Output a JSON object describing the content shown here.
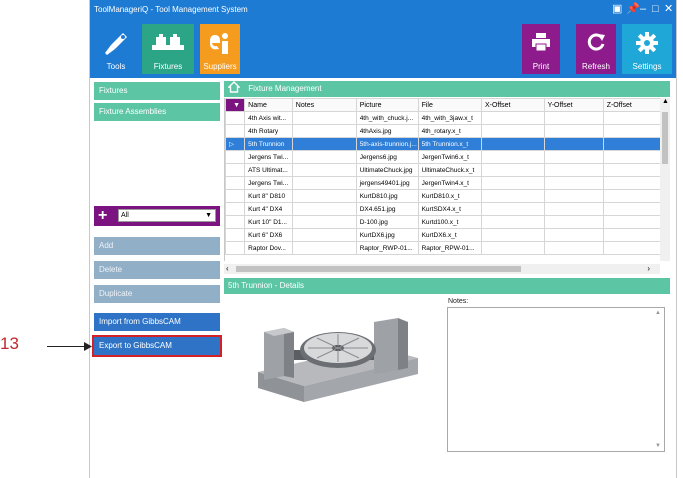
{
  "window": {
    "title": "ToolManageriQ - Tool Management System"
  },
  "toolbar": {
    "tools": "Tools",
    "fixtures": "Fixtures",
    "suppliers": "Suppliers",
    "print": "Print",
    "refresh": "Refresh",
    "settings": "Settings"
  },
  "sidebar": {
    "fixtures": "Fixtures",
    "fixture_assemblies": "Fixture Assemblies",
    "filter_value": "All",
    "add": "Add",
    "delete": "Delete",
    "duplicate": "Duplicate",
    "import": "Import from GibbsCAM",
    "export": "Export to GibbsCAM"
  },
  "fixture_management": {
    "title": "Fixture Management",
    "columns": [
      "Name",
      "Notes",
      "Picture",
      "File",
      "X-Offset",
      "Y-Offset",
      "Z-Offset"
    ],
    "rows": [
      [
        "4th Axis wit...",
        "",
        "4th_with_chuck.j...",
        "4th_with_3jaw.x_t",
        "",
        "",
        ""
      ],
      [
        "4th Rotary",
        "",
        "4thAxis.jpg",
        "4th_rotary.x_t",
        "",
        "",
        ""
      ],
      [
        "5th Trunnion",
        "",
        "5th-axis-trunnion.j...",
        "5th Trunnion.x_t",
        "",
        "",
        ""
      ],
      [
        "Jergens Twi...",
        "",
        "Jergens6.jpg",
        "JergenTwin6.x_t",
        "",
        "",
        ""
      ],
      [
        "ATS Ultimat...",
        "",
        "UltimateChuck.jpg",
        "UltimateChuck.x_t",
        "",
        "",
        ""
      ],
      [
        "Jergens Twi...",
        "",
        "jergens49401.jpg",
        "JergenTwin4.x_t",
        "",
        "",
        ""
      ],
      [
        "Kurt 8\" D810",
        "",
        "KurtD810.jpg",
        "KurtD810.x_t",
        "",
        "",
        ""
      ],
      [
        "Kurt 4\" DX4",
        "",
        "DX4.651.jpg",
        "KurtSDX4.x_t",
        "",
        "",
        ""
      ],
      [
        "Kurt 10\" D1...",
        "",
        "D-100.jpg",
        "Kurtd100.x_t",
        "",
        "",
        ""
      ],
      [
        "Kurt 6\" DX6",
        "",
        "KurtDX6.jpg",
        "KurtDX6.x_t",
        "",
        "",
        ""
      ],
      [
        "Raptor Dov...",
        "",
        "Raptor_RWP-01...",
        "Raptor_RPW-01...",
        "",
        "",
        ""
      ]
    ],
    "selected_row": 2
  },
  "details": {
    "title": "5th Trunnion - Details",
    "notes_label": "Notes:"
  },
  "annotation": {
    "number": "13"
  },
  "colors": {
    "accent": "#1e7bd3",
    "teal": "#5cc5a4",
    "purple": "#7b1481",
    "orange": "#f59b1d",
    "cyan": "#1fa7d8"
  }
}
